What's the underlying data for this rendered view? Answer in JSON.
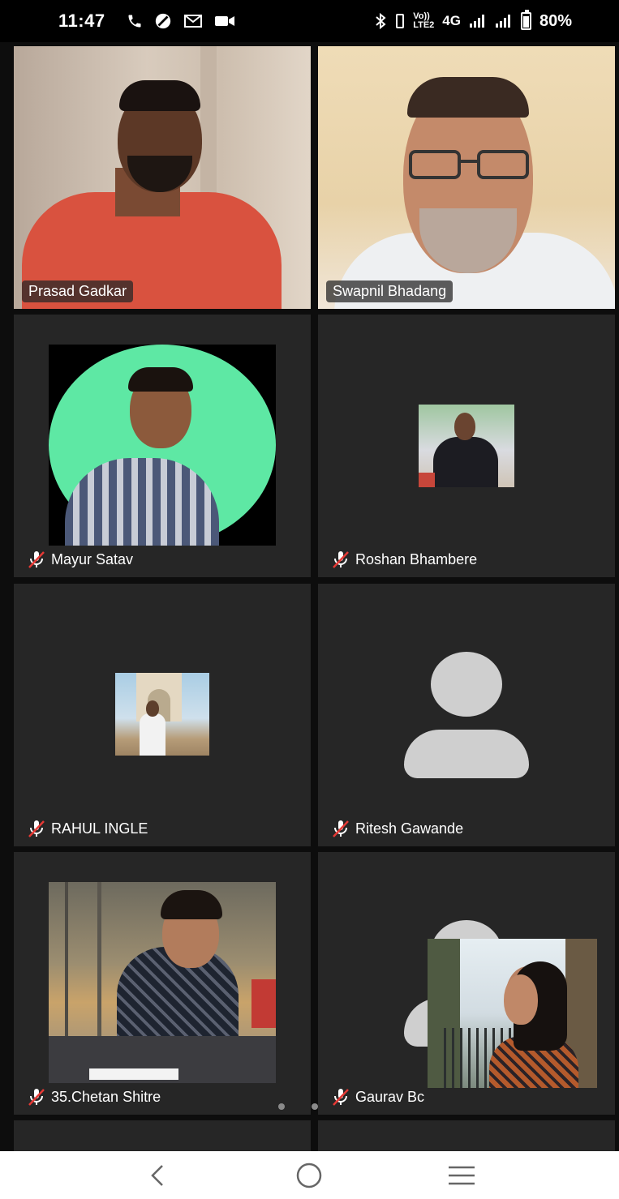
{
  "status_bar": {
    "time": "11:47",
    "network_label": "4G",
    "volte_label": "Vo))\nLTE2",
    "battery": "80%"
  },
  "participants": [
    {
      "name": "Prasad Gadkar",
      "muted": false,
      "speaking": true,
      "view": "video"
    },
    {
      "name": "Swapnil Bhadang",
      "muted": false,
      "speaking": false,
      "view": "video"
    },
    {
      "name": "Mayur Satav",
      "muted": true,
      "view": "profile-photo"
    },
    {
      "name": "Roshan Bhambere",
      "muted": true,
      "view": "profile-photo"
    },
    {
      "name": "RAHUL INGLE",
      "muted": true,
      "view": "profile-photo"
    },
    {
      "name": "Ritesh Gawande",
      "muted": true,
      "view": "default-avatar"
    },
    {
      "name": "35.Chetan Shitre",
      "muted": true,
      "view": "profile-photo"
    },
    {
      "name": "Gaurav Bc",
      "muted": true,
      "view": "default-avatar"
    }
  ],
  "self_view": {
    "view": "video"
  },
  "pagination": {
    "pages": 2,
    "current": 1
  },
  "colors": {
    "active_speaker_border": "#2ecc40",
    "tile_background": "#262626",
    "avatar_circle_green": "#5ee8a4",
    "placeholder_gray": "#cfcfcf"
  },
  "icons": [
    "phone-icon",
    "data-saver-icon",
    "gmail-icon",
    "video-camera-icon",
    "bluetooth-icon",
    "signal-icon",
    "battery-icon",
    "mic-off-icon",
    "back-icon",
    "home-icon",
    "recents-icon"
  ]
}
